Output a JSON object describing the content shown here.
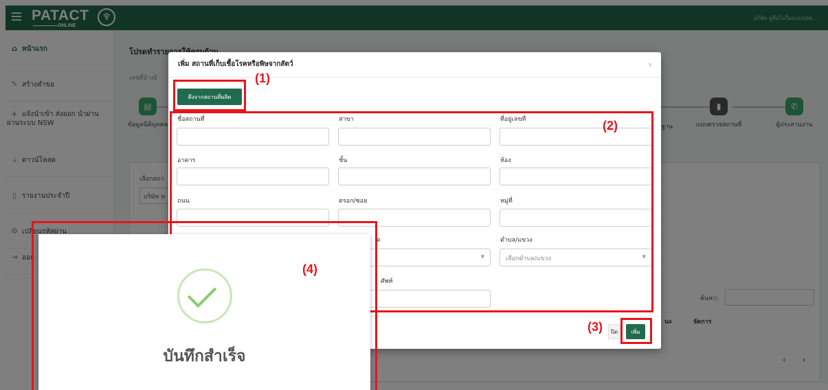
{
  "topbar": {
    "logo": "PATACT",
    "logo_sub": "ONLINE",
    "user": "บริษัท ทูลือไบรือแบบปลด..."
  },
  "sidebar": {
    "items": [
      {
        "label": "หน้าแรก",
        "icon": "home-icon"
      },
      {
        "label": "สร้างคำขอ",
        "icon": "pencil-icon"
      },
      {
        "label": "แจ้งนำเข้า ส่งออก นำผ่าน ผ่านระบบ NSW",
        "icon": "plane-icon"
      },
      {
        "label": "ดาวน์โหลด",
        "icon": "download-icon"
      },
      {
        "label": "รายงานประจำปี",
        "icon": "file-icon"
      },
      {
        "label": "เปลี่ยนรหัสผ่าน",
        "icon": "gear-icon"
      },
      {
        "label": "ออก",
        "icon": "logout-icon"
      }
    ]
  },
  "main": {
    "title": "โปรดทำรายการให้ครบถ้วน",
    "sub": "เลขที่อ้างอิ",
    "steps": [
      "ข้อมูลนิติบุคคล",
      "ฐาน",
      "แบบตรวจสถานที่",
      "ผู้ประสานงาน"
    ],
    "panel_label": "เลือกสถา",
    "panel_select": "บริษัท ท",
    "search_label": "ค้นหา:",
    "col_status": "นะ",
    "col_manage": "จัดการ"
  },
  "modal": {
    "title": "เพิ่ม สถานที่เก็บเชื้อโรคหรือพิษจากสัตว์",
    "close": "×",
    "pull_button": "ดึงจากสถานที่ผลิต",
    "fields": {
      "place_name": "ชื่อสถานที่",
      "branch": "สาขา",
      "address_no": "ที่อยู่เลขที่",
      "building": "อาคาร",
      "floor": "ชั้น",
      "room": "ห้อง",
      "road": "ถนน",
      "alley": "ตรอก/ซอย",
      "moo": "หมู่ที่",
      "district_short": "ด",
      "subdistrict": "ตำบล/แขวง",
      "district_placeholder": "ด",
      "subdistrict_placeholder": "เลือกตำบล/แขวง",
      "phone": "ศัพท์"
    },
    "close_button": "ปิด",
    "add_button": "เพิ่ม"
  },
  "annotations": [
    "(1)",
    "(2)",
    "(3)",
    "(4)"
  ],
  "popup": {
    "message": "บันทึกสำเร็จ"
  },
  "colors": {
    "brand": "#206b4e",
    "annotation": "#e8141c"
  }
}
